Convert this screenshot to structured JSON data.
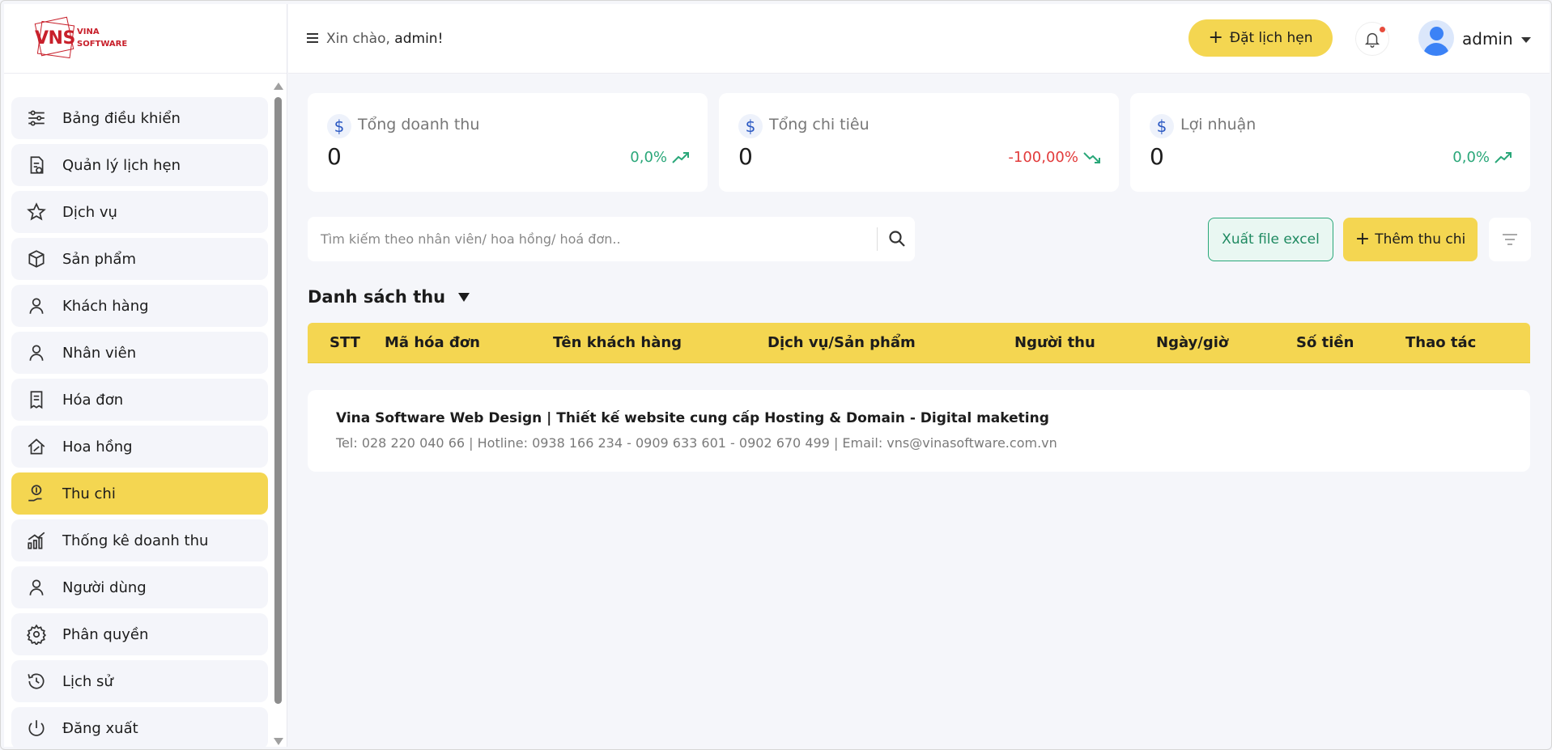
{
  "brand": {
    "logo_main": "VNS",
    "logo_line1": "VINA",
    "logo_line2": "SOFTWARE"
  },
  "header": {
    "greeting": "Xin chào,",
    "user_inline": "admin!",
    "book_button": "Đặt lịch hẹn",
    "user_name": "admin"
  },
  "sidebar": {
    "items": [
      {
        "label": "Bảng điều khiển",
        "icon": "sliders-icon"
      },
      {
        "label": "Quản lý lịch hẹn",
        "icon": "appointment-doc-icon"
      },
      {
        "label": "Dịch vụ",
        "icon": "star-icon"
      },
      {
        "label": "Sản phẩm",
        "icon": "box-icon"
      },
      {
        "label": "Khách hàng",
        "icon": "user-icon"
      },
      {
        "label": "Nhân viên",
        "icon": "user-icon"
      },
      {
        "label": "Hóa đơn",
        "icon": "receipt-icon"
      },
      {
        "label": "Hoa hồng",
        "icon": "house-percent-icon"
      },
      {
        "label": "Thu chi",
        "icon": "money-hand-icon",
        "active": true
      },
      {
        "label": "Thống kê doanh thu",
        "icon": "chart-growth-icon"
      },
      {
        "label": "Người dùng",
        "icon": "user-icon"
      },
      {
        "label": "Phân quyền",
        "icon": "gear-icon"
      },
      {
        "label": "Lịch sử",
        "icon": "history-icon"
      },
      {
        "label": "Đăng xuất",
        "icon": "power-icon"
      }
    ]
  },
  "stats": [
    {
      "label": "Tổng doanh thu",
      "value": "0",
      "delta": "0,0%",
      "trend": "up"
    },
    {
      "label": "Tổng chi tiêu",
      "value": "0",
      "delta": "-100,00%",
      "trend": "down"
    },
    {
      "label": "Lợi nhuận",
      "value": "0",
      "delta": "0,0%",
      "trend": "up"
    }
  ],
  "toolbar": {
    "search_placeholder": "Tìm kiếm theo nhân viên/ hoa hồng/ hoá đơn..",
    "excel_button": "Xuất file excel",
    "add_button": "Thêm thu chi"
  },
  "list": {
    "title": "Danh sách thu",
    "columns": [
      "STT",
      "Mã hóa đơn",
      "Tên khách hàng",
      "Dịch vụ/Sản phẩm",
      "Người thu",
      "Ngày/giờ",
      "Số tiền",
      "Thao tác"
    ]
  },
  "footer": {
    "line1": "Vina Software Web Design | Thiết kế website cung cấp Hosting & Domain - Digital maketing",
    "line2": "Tel: 028 220 040 66 | Hotline: 0938 166 234 - 0909 633 601 - 0902 670 499 | Email: vns@vinasoftware.com.vn"
  },
  "colors": {
    "accent": "#f4d651",
    "positive": "#2aa779",
    "negative": "#e23b3b",
    "brand": "#c8202b"
  }
}
